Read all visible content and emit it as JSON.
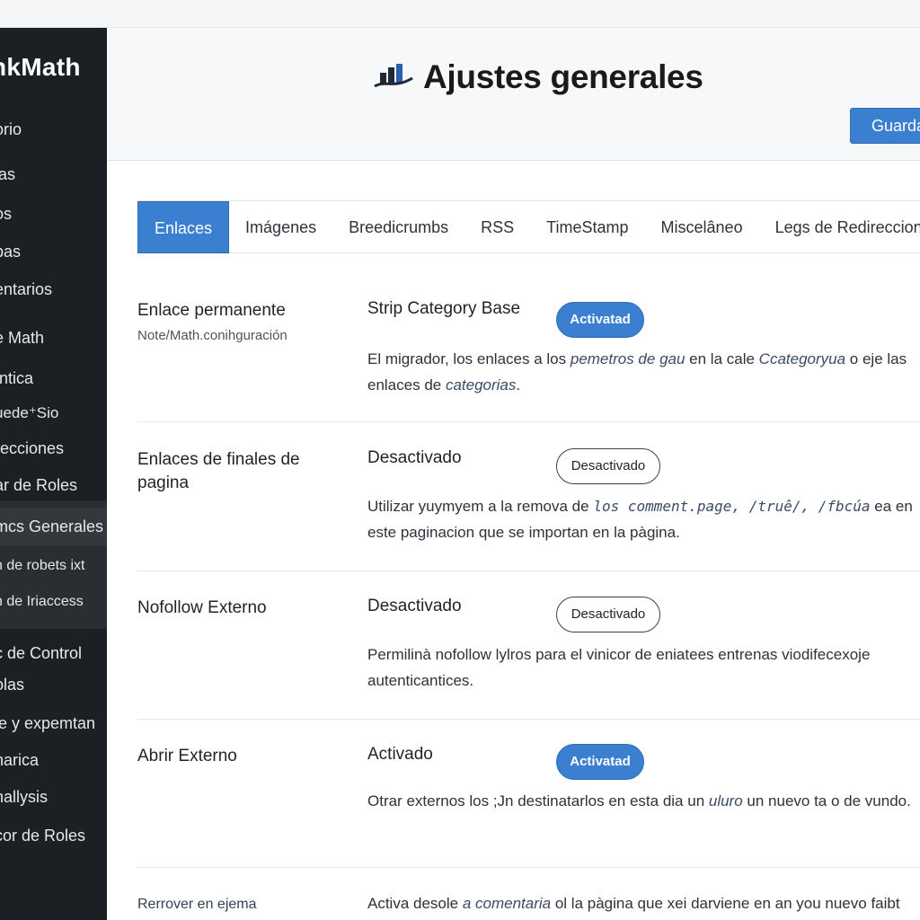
{
  "sidebar": {
    "brand": "nkMath",
    "items": [
      {
        "label": "orio"
      },
      {
        "label": "las"
      },
      {
        "label": "os"
      },
      {
        "label": "pas"
      },
      {
        "label": "entarios"
      },
      {
        "label": "e Math"
      },
      {
        "label": "Intica"
      },
      {
        "label": "uede⁺Sio"
      },
      {
        "label": "recciones"
      },
      {
        "label": "ar de Roles"
      },
      {
        "label": "mcs Generales"
      },
      {
        "label": "n de robets ixt"
      },
      {
        "label": "n de Iriaccess"
      },
      {
        "label": "c de Control"
      },
      {
        "label": "olas"
      },
      {
        "label": "le y expemtan"
      },
      {
        "label": "narica"
      },
      {
        "label": "nallysis"
      },
      {
        "label": "cor de Roles"
      }
    ]
  },
  "header": {
    "title": "Ajustes generales",
    "save_label": "Guardar",
    "icon": "rankmath-chart-icon"
  },
  "tabs": [
    {
      "label": "Enlaces",
      "active": true
    },
    {
      "label": "Imágenes"
    },
    {
      "label": "Breedicrumbs"
    },
    {
      "label": "RSS"
    },
    {
      "label": "TimeStamp"
    },
    {
      "label": "Miscelâneo"
    },
    {
      "label": "Legs de Redirecciones"
    }
  ],
  "rows": [
    {
      "label": "Enlace permanente",
      "sublabel": "Note/Math.conihguración",
      "setting": "Strip Category Base",
      "toggle": "Activatad",
      "desc_parts": [
        "El migrador, los enlaces a los ",
        "pemetros de gau",
        " en la cale ",
        "Ccategoryua",
        " o eje las enlaces de ",
        "categorias",
        "."
      ]
    },
    {
      "label": "Enlaces de finales de pagina",
      "setting": "Desactivado",
      "toggle": "Desactivado",
      "desc_parts": [
        "Utilizar yuymyem a la remova de ",
        "los comment.page, /truê/, /fbcúa",
        " ea en este paginacion que se importan en la pàgina."
      ]
    },
    {
      "label": "Nofollow Externo",
      "setting": "Desactivado",
      "toggle": "Desactivado",
      "desc": "Permilinà nofollow lylros para el vinicor de eniatees entrenas viodifecexoje autenticantices."
    },
    {
      "label": "Abrir Externo",
      "setting": "Activado",
      "toggle": "Activatad",
      "desc_parts": [
        "Otrar externos los ;Jn destinatarlos en esta dia un ",
        "uluro",
        " un nuevo ta o de vundo."
      ]
    }
  ],
  "bottom": {
    "label": "Rerrover en ejema",
    "desc_parts": [
      "Activa desole ",
      "a comentaria",
      " ol la pàgina que xei darviene en an you nuevo faibt"
    ]
  },
  "colors": {
    "accent": "#3a7fd0",
    "sidebar_bg": "#1c1f23"
  }
}
